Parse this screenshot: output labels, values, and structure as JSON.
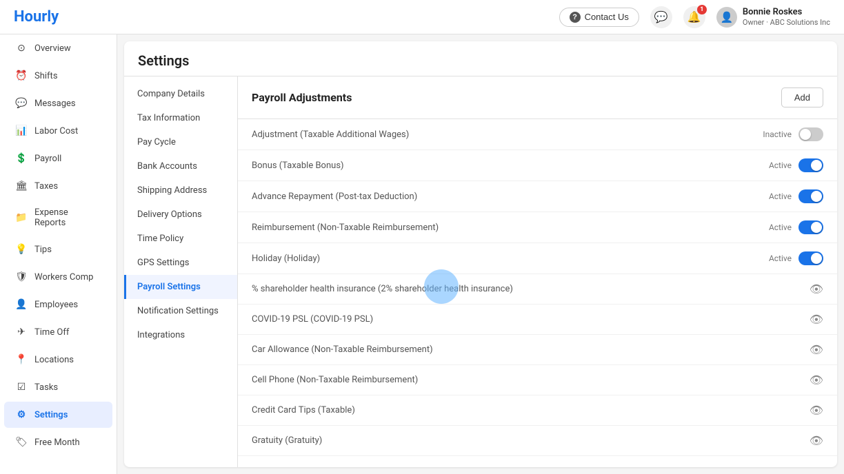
{
  "header": {
    "logo": "Hourly",
    "contact_us": "Contact Us",
    "notification_count": "1",
    "user_name": "Bonnie Roskes",
    "user_role": "Owner · ABC Solutions Inc"
  },
  "sidebar": {
    "items": [
      {
        "id": "overview",
        "label": "Overview",
        "icon": "⊙"
      },
      {
        "id": "shifts",
        "label": "Shifts",
        "icon": "⏰"
      },
      {
        "id": "messages",
        "label": "Messages",
        "icon": "💬"
      },
      {
        "id": "labor-cost",
        "label": "Labor Cost",
        "icon": "📊"
      },
      {
        "id": "payroll",
        "label": "Payroll",
        "icon": "💲"
      },
      {
        "id": "taxes",
        "label": "Taxes",
        "icon": "🏛"
      },
      {
        "id": "expense-reports",
        "label": "Expense Reports",
        "icon": "📁"
      },
      {
        "id": "tips",
        "label": "Tips",
        "icon": "💡"
      },
      {
        "id": "workers-comp",
        "label": "Workers Comp",
        "icon": "🛡"
      },
      {
        "id": "employees",
        "label": "Employees",
        "icon": "👤"
      },
      {
        "id": "time-off",
        "label": "Time Off",
        "icon": "✈"
      },
      {
        "id": "locations",
        "label": "Locations",
        "icon": "📍"
      },
      {
        "id": "tasks",
        "label": "Tasks",
        "icon": "☑"
      },
      {
        "id": "settings",
        "label": "Settings",
        "icon": "⚙"
      },
      {
        "id": "free-month",
        "label": "Free Month",
        "icon": "🏷"
      }
    ]
  },
  "settings": {
    "title": "Settings",
    "nav_items": [
      {
        "id": "company-details",
        "label": "Company Details"
      },
      {
        "id": "tax-information",
        "label": "Tax Information"
      },
      {
        "id": "pay-cycle",
        "label": "Pay Cycle"
      },
      {
        "id": "bank-accounts",
        "label": "Bank Accounts"
      },
      {
        "id": "shipping-address",
        "label": "Shipping Address"
      },
      {
        "id": "delivery-options",
        "label": "Delivery Options"
      },
      {
        "id": "time-policy",
        "label": "Time Policy"
      },
      {
        "id": "gps-settings",
        "label": "GPS Settings"
      },
      {
        "id": "payroll-settings",
        "label": "Payroll Settings",
        "active": true
      },
      {
        "id": "notification-settings",
        "label": "Notification Settings"
      },
      {
        "id": "integrations",
        "label": "Integrations"
      }
    ]
  },
  "payroll_adjustments": {
    "title": "Payroll Adjustments",
    "add_label": "Add",
    "rows": [
      {
        "id": "adj1",
        "name": "Adjustment (Taxable Additional Wages)",
        "status": "Inactive",
        "toggle": "off",
        "show_toggle": true
      },
      {
        "id": "adj2",
        "name": "Bonus (Taxable Bonus)",
        "status": "Active",
        "toggle": "on",
        "show_toggle": true
      },
      {
        "id": "adj3",
        "name": "Advance Repayment (Post-tax Deduction)",
        "status": "Active",
        "toggle": "on",
        "show_toggle": true
      },
      {
        "id": "adj4",
        "name": "Reimbursement (Non-Taxable Reimbursement)",
        "status": "Active",
        "toggle": "on",
        "show_toggle": true
      },
      {
        "id": "adj5",
        "name": "Holiday (Holiday)",
        "status": "Active",
        "toggle": "on",
        "show_toggle": true
      },
      {
        "id": "adj6",
        "name": "% shareholder health insurance (2% shareholder health insurance)",
        "status": "",
        "toggle": null,
        "show_eye": true
      },
      {
        "id": "adj7",
        "name": "COVID-19 PSL (COVID-19 PSL)",
        "status": "",
        "toggle": null,
        "show_eye": true
      },
      {
        "id": "adj8",
        "name": "Car Allowance (Non-Taxable Reimbursement)",
        "status": "",
        "toggle": null,
        "show_eye": true
      },
      {
        "id": "adj9",
        "name": "Cell Phone (Non-Taxable Reimbursement)",
        "status": "",
        "toggle": null,
        "show_eye": true
      },
      {
        "id": "adj10",
        "name": "Credit Card Tips (Taxable)",
        "status": "",
        "toggle": null,
        "show_eye": true
      },
      {
        "id": "adj11",
        "name": "Gratuity (Gratuity)",
        "status": "",
        "toggle": null,
        "show_eye": true
      }
    ]
  }
}
